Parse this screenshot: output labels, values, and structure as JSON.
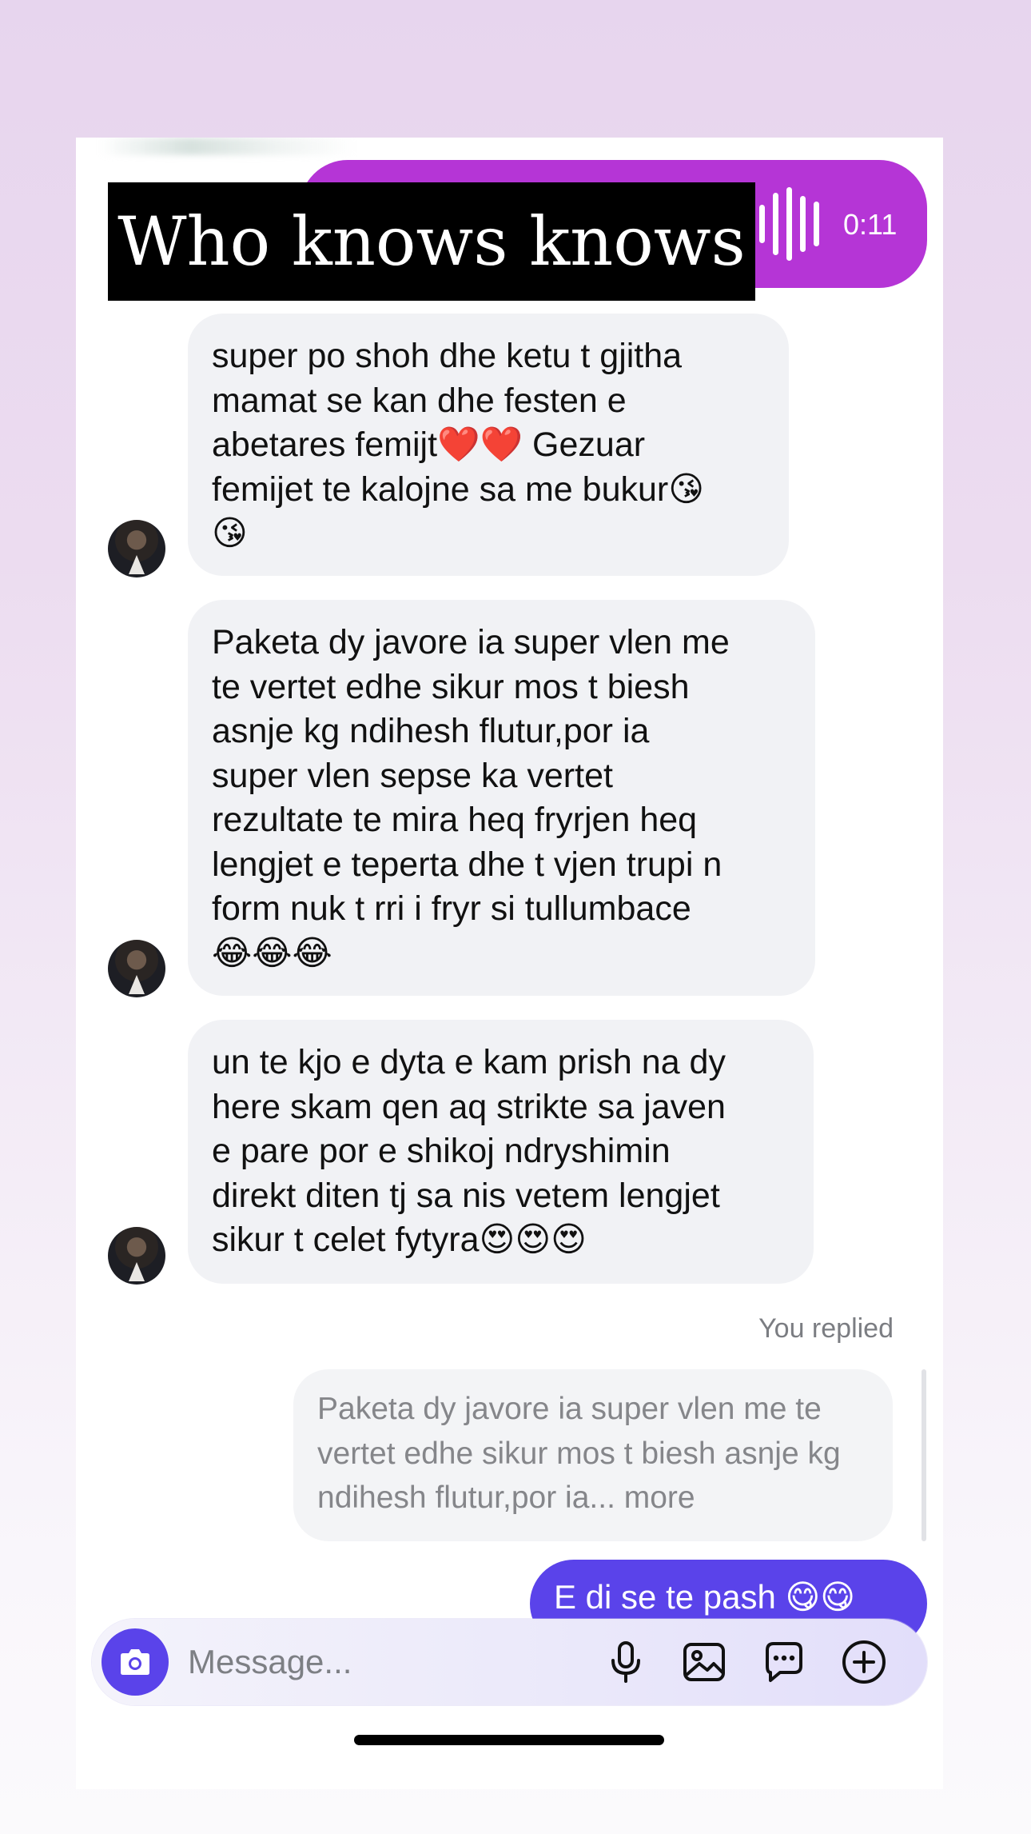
{
  "voice_message": {
    "duration": "0:11"
  },
  "overlay": {
    "caption": "Who knows knows"
  },
  "messages": [
    {
      "text": "super po shoh dhe ketu t gjitha\nmamat se kan dhe festen e\nabetares femijt❤️❤️ Gezuar\nfemijet te kalojne sa me bukur😘\n😘"
    },
    {
      "text": "Paketa dy javore ia super vlen me\nte vertet edhe sikur mos t biesh\nasnje kg ndihesh flutur,por ia\nsuper vlen sepse ka vertet\nrezultate te mira heq fryrjen heq\nlengjet e teperta dhe t vjen trupi n\nform nuk t rri i fryr si tullumbace\n😂😂😂"
    },
    {
      "text": "un te kjo e dyta e kam prish na dy\nhere skam qen aq strikte sa javen\ne pare por e shikoj ndryshimin\ndirekt diten tj sa nis vetem lengjet\nsikur t celet fytyra😍😍😍"
    }
  ],
  "reply": {
    "label": "You replied",
    "quote_text": "Paketa dy javore ia super vlen me te vertet edhe sikur mos t biesh asnje kg ndihesh flutur,por ia...",
    "more": "more"
  },
  "sent_message": {
    "text": "E di se te pash 😋😋"
  },
  "composer": {
    "placeholder": "Message...",
    "icons": [
      "camera-icon",
      "microphone-icon",
      "gallery-icon",
      "sticker-chat-icon",
      "add-icon"
    ]
  },
  "colors": {
    "voice_bubble": "#b535d6",
    "sent_bubble": "#5a43ea",
    "received_bubble": "#f1f2f5"
  }
}
